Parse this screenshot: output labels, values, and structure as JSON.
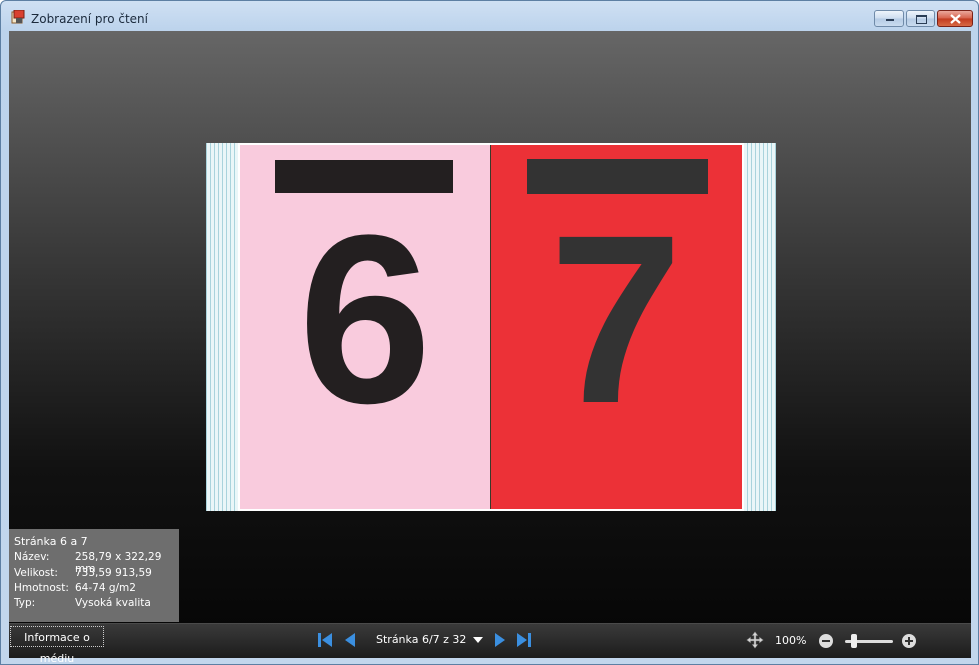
{
  "window": {
    "title": "Zobrazení pro čtení"
  },
  "book": {
    "left_page_number": "6",
    "right_page_number": "7",
    "left_page_color": "#f9cbdd",
    "right_page_color": "#ec3137"
  },
  "info": {
    "title": "Stránka 6 a 7",
    "rows": [
      {
        "label": "Název:",
        "value": "258,79 x 322,29 mm"
      },
      {
        "label": "Velikost:",
        "value": "733,59 913,59"
      },
      {
        "label": "Hmotnost:",
        "value": "64-74 g/m2"
      },
      {
        "label": "Typ:",
        "value": "Vysoká kvalita"
      }
    ]
  },
  "toolbar": {
    "media_info_label": "Informace o médiu",
    "page_select_value": "Stránka 6/7 z 32",
    "zoom_level": "100%",
    "zoom_fraction": 0.15,
    "accent_color": "#3b8fe0"
  },
  "icons": [
    "app-icon",
    "minimize-icon",
    "maximize-icon",
    "close-icon",
    "first-page-icon",
    "previous-page-icon",
    "next-page-icon",
    "last-page-icon",
    "pan-icon",
    "zoom-out-icon",
    "zoom-in-icon",
    "chevron-down-icon"
  ]
}
